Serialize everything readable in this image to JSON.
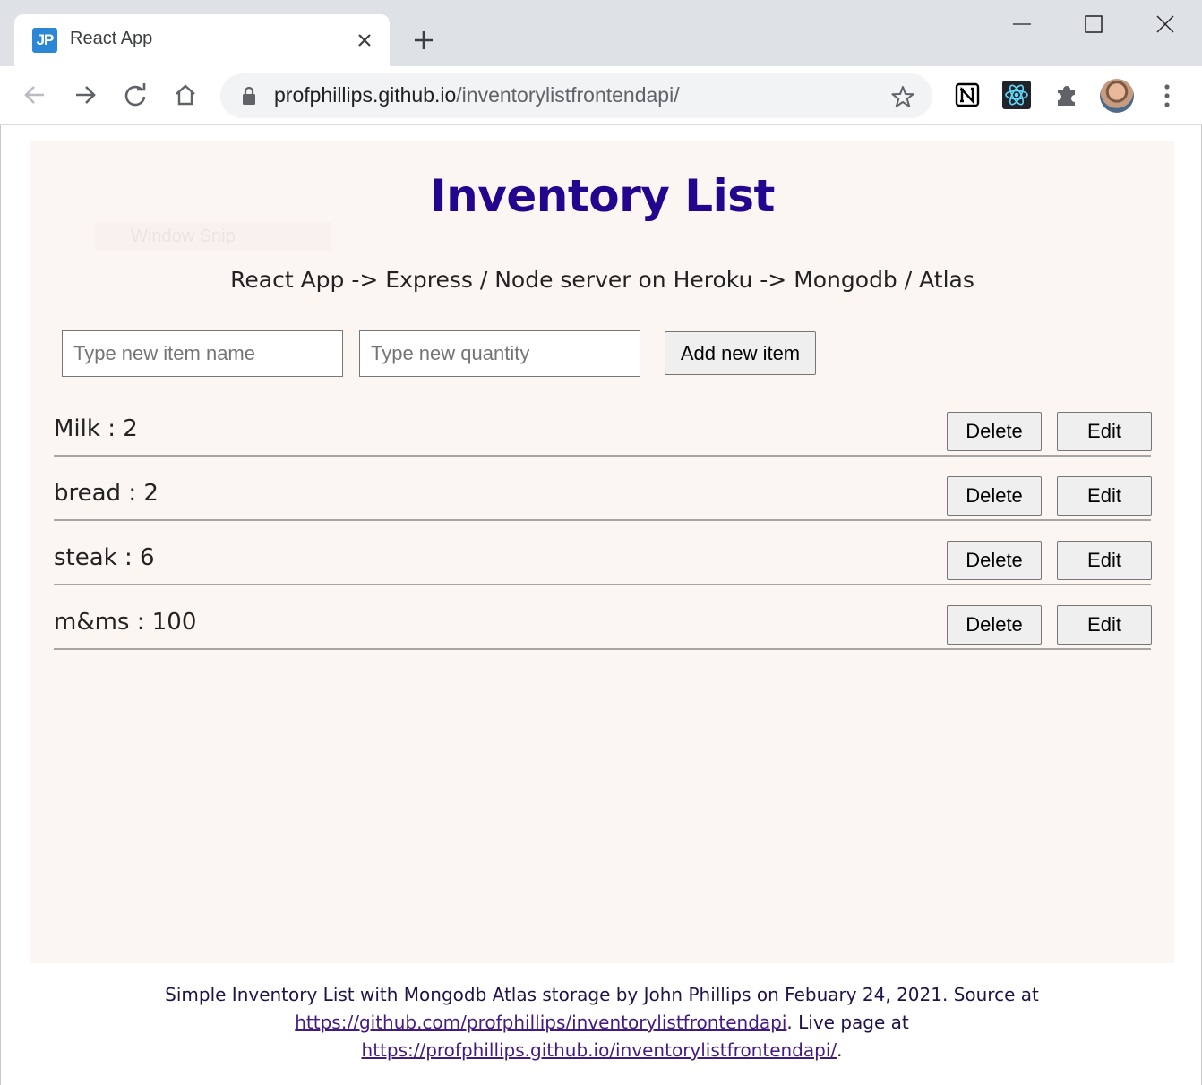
{
  "browser": {
    "tab_favicon_text": "JP",
    "tab_title": "React App",
    "url_host": "profphillips.github.io",
    "url_path": "/inventorylistfrontendapi/"
  },
  "app": {
    "title": "Inventory List",
    "ghost_overlay": "Window Snip",
    "subtitle": "React App -> Express / Node server on Heroku -> Mongodb / Atlas",
    "name_input": {
      "placeholder": "Type new item name",
      "value": ""
    },
    "quantity_input": {
      "placeholder": "Type new quantity",
      "value": ""
    },
    "add_button": "Add new item",
    "items": [
      {
        "text": "Milk : 2",
        "delete": "Delete",
        "edit": "Edit"
      },
      {
        "text": "bread : 2",
        "delete": "Delete",
        "edit": "Edit"
      },
      {
        "text": "steak : 6",
        "delete": "Delete",
        "edit": "Edit"
      },
      {
        "text": "m&ms : 100",
        "delete": "Delete",
        "edit": "Edit"
      }
    ]
  },
  "footer": {
    "text_1": "Simple Inventory List with Mongodb Atlas storage by John Phillips on Febuary 24, 2021. Source at",
    "link_1": "https://github.com/profphillips/inventorylistfrontendapi",
    "text_2": ". Live page at",
    "link_2": "https://profphillips.github.io/inventorylistfrontendapi/",
    "text_3": "."
  },
  "colors": {
    "title": "#22078e",
    "app_background": "#fcf6f3",
    "chrome_background": "#dee1e6",
    "link": "#451a80"
  }
}
